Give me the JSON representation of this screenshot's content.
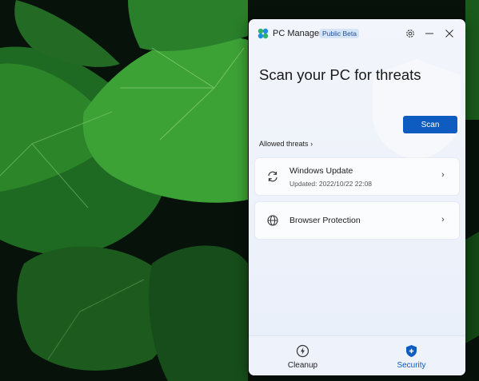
{
  "colors": {
    "accent": "#0f5cc0",
    "window_bg": "#f2f5fb",
    "card_bg": "#fbfcfe",
    "badge_bg": "#d6e4f7",
    "wallpaper_leaf": "#2e8a2a"
  },
  "app": {
    "title": "PC Manager",
    "badge": "Public Beta",
    "icons": {
      "logo": "pc-manager-logo",
      "settings": "gear-icon",
      "minimize": "minimize-icon",
      "close": "close-icon"
    }
  },
  "hero": {
    "title": "Scan your PC for threats",
    "allowed_threats_label": "Allowed threats",
    "allowed_threats_chevron": "›",
    "scan_button_label": "Scan"
  },
  "items": [
    {
      "title": "Windows Update",
      "subtitle": "Updated: 2022/10/22 22:08",
      "icon": "refresh-icon",
      "chevron": "›"
    },
    {
      "title": "Browser Protection",
      "icon": "globe-icon",
      "chevron": "›"
    }
  ],
  "nav": {
    "cleanup_label": "Cleanup",
    "security_label": "Security",
    "active": "security",
    "icons": {
      "cleanup": "lightning-icon",
      "security": "shield-icon"
    }
  }
}
